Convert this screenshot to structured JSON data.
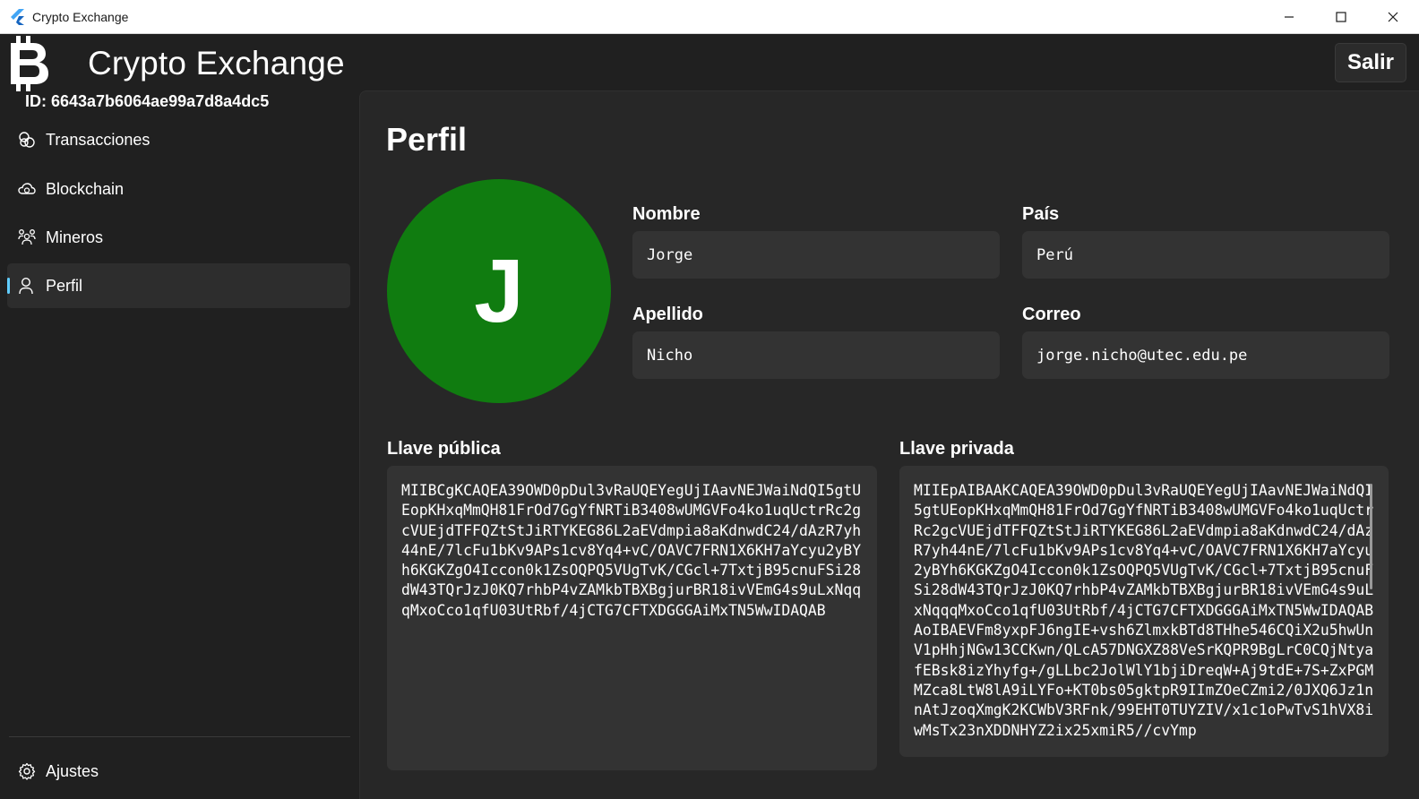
{
  "window": {
    "title": "Crypto Exchange",
    "controls": [
      "minimize-icon",
      "maximize-icon",
      "close-icon"
    ]
  },
  "header": {
    "app_title": "Crypto Exchange",
    "logo_icon": "bitcoin-icon",
    "exit_label": "Salir"
  },
  "user": {
    "id_label": "ID: 6643a7b6064ae99a7d8a4dc5"
  },
  "sidebar": {
    "items": [
      {
        "label": "Transacciones",
        "icon": "transactions-icon",
        "active": false
      },
      {
        "label": "Blockchain",
        "icon": "cloud-icon",
        "active": false
      },
      {
        "label": "Mineros",
        "icon": "people-icon",
        "active": false
      },
      {
        "label": "Perfil",
        "icon": "person-icon",
        "active": true
      }
    ],
    "footer": {
      "label": "Ajustes",
      "icon": "gear-icon"
    },
    "accent_color": "#60cdff"
  },
  "profile": {
    "title": "Perfil",
    "avatar_initial": "J",
    "avatar_color": "#107c10",
    "fields": {
      "nombre": {
        "label": "Nombre",
        "value": "Jorge"
      },
      "pais": {
        "label": "País",
        "value": "Perú"
      },
      "apellido": {
        "label": "Apellido",
        "value": "Nicho"
      },
      "correo": {
        "label": "Correo",
        "value": "jorge.nicho@utec.edu.pe"
      }
    },
    "public_key": {
      "label": "Llave pública",
      "value": "MIIBCgKCAQEA39OWD0pDul3vRaUQEYegUjIAavNEJWaiNdQI5gtUEopKHxqMmQH81FrOd7GgYfNRTiB3408wUMGVFo4ko1uqUctrRc2gcVUEjdTFFQZtStJiRTYKEG86L2aEVdmpia8aKdnwdC24/dAzR7yh44nE/7lcFu1bKv9APs1cv8Yq4+vC/OAVC7FRN1X6KH7aYcyu2yBYh6KGKZgO4Iccon0k1ZsOQPQ5VUgTvK/CGcl+7TxtjB95cnuFSi28dW43TQrJzJ0KQ7rhbP4vZAMkbTBXBgjurBR18ivVEmG4s9uLxNqqqMxoCco1qfU03UtRbf/4jCTG7CFTXDGGGAiMxTN5WwIDAQAB"
    },
    "private_key": {
      "label": "Llave privada",
      "value": "MIIEpAIBAAKCAQEA39OWD0pDul3vRaUQEYegUjIAavNEJWaiNdQI5gtUEopKHxqMmQH81FrOd7GgYfNRTiB3408wUMGVFo4ko1uqUctrRc2gcVUEjdTFFQZtStJiRTYKEG86L2aEVdmpia8aKdnwdC24/dAzR7yh44nE/7lcFu1bKv9APs1cv8Yq4+vC/OAVC7FRN1X6KH7aYcyu2yBYh6KGKZgO4Iccon0k1ZsOQPQ5VUgTvK/CGcl+7TxtjB95cnuFSi28dW43TQrJzJ0KQ7rhbP4vZAMkbTBXBgjurBR18ivVEmG4s9uLxNqqqMxoCco1qfU03UtRbf/4jCTG7CFTXDGGGAiMxTN5WwIDAQABAoIBAEVFm8yxpFJ6ngIE+vsh6ZlmxkBTd8THhe546CQiX2u5hwUnV1pHhjNGw13CCKwn/QLcA57DNGXZ88VeSrKQPR9BgLrC0CQjNtyafEBsk8izYhyfg+/gLLbc2JolWlY1bjiDreqW+Aj9tdE+7S+ZxPGMMZca8LtW8lA9iLYFo+KT0bs05gktpR9IImZOeCZmi2/0JXQ6Jz1nnAtJzoqXmgK2KCWbV3RFnk/99EHT0TUYZIV/x1c1oPwTvS1hVX8iwMsTx23nXDDNHYZ2ix25xmiR5//cvYmp"
    }
  }
}
